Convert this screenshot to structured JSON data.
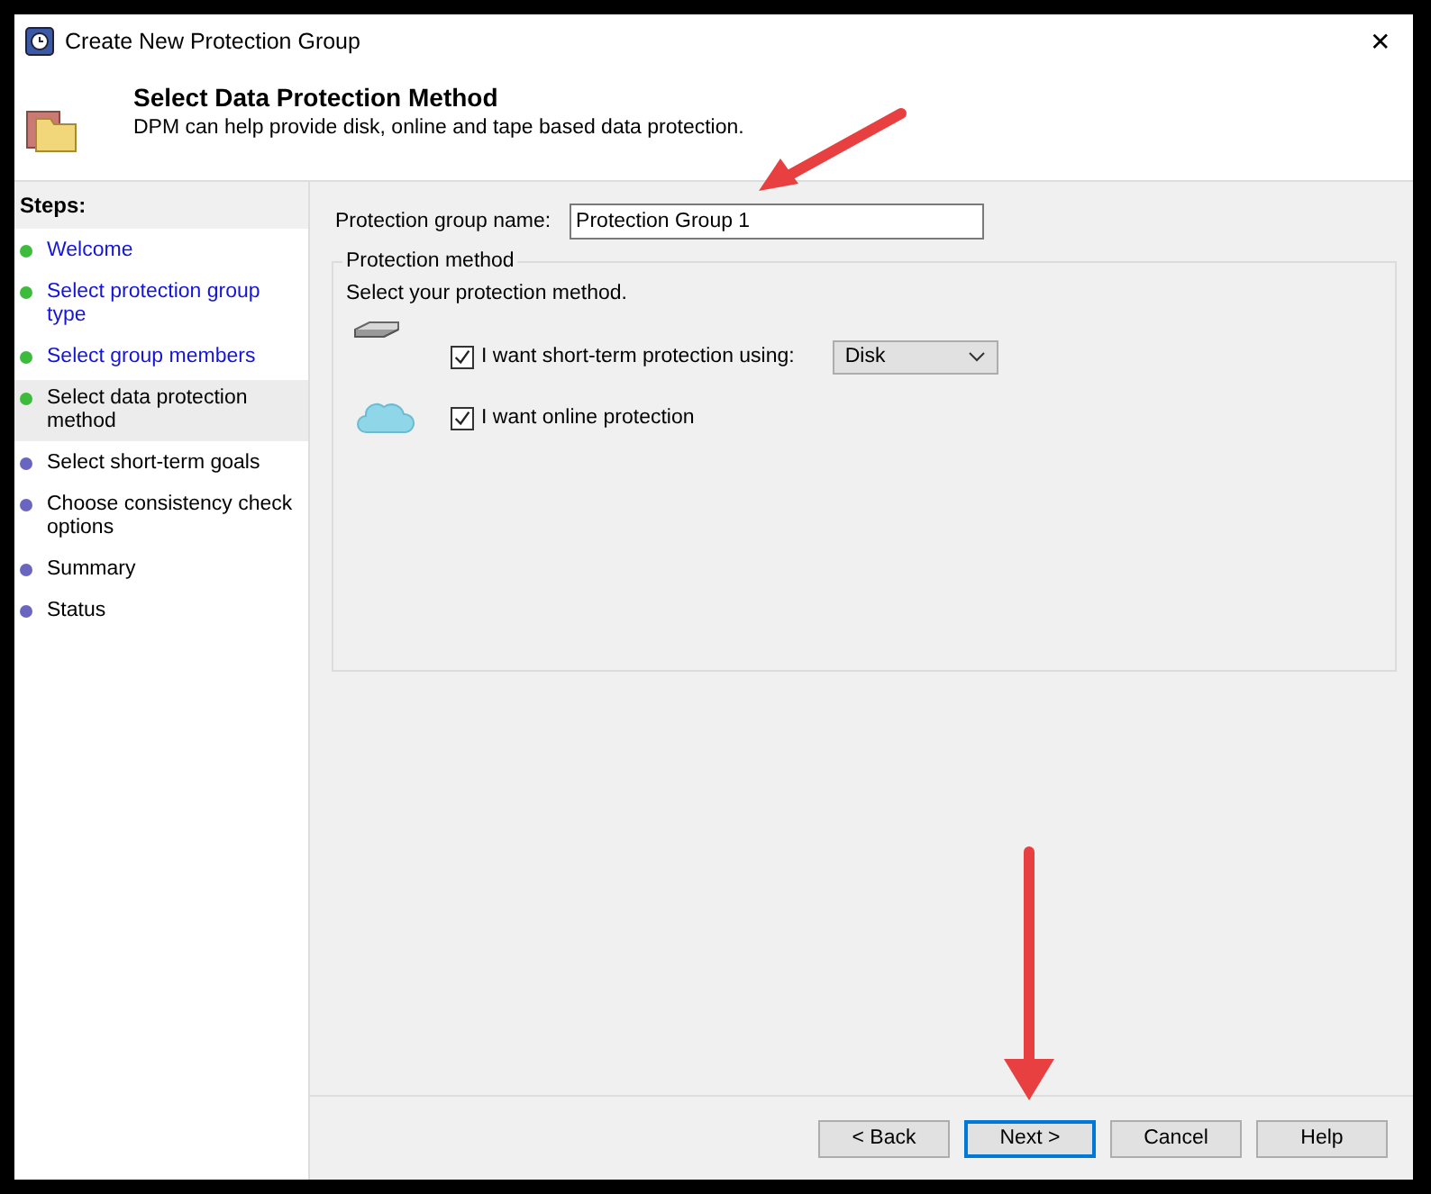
{
  "window": {
    "title": "Create New Protection Group",
    "close": "✕"
  },
  "header": {
    "title": "Select Data Protection Method",
    "subtitle": "DPM can help provide disk, online and tape based data protection."
  },
  "steps": {
    "heading": "Steps:",
    "items": [
      {
        "label": "Welcome",
        "completed": true,
        "selected": false
      },
      {
        "label": "Select protection group type",
        "completed": true,
        "selected": false
      },
      {
        "label": "Select group members",
        "completed": true,
        "selected": false
      },
      {
        "label": "Select data protection method",
        "completed": true,
        "selected": true
      },
      {
        "label": "Select short-term goals",
        "completed": false,
        "selected": false
      },
      {
        "label": "Choose consistency check options",
        "completed": false,
        "selected": false
      },
      {
        "label": "Summary",
        "completed": false,
        "selected": false
      },
      {
        "label": "Status",
        "completed": false,
        "selected": false
      }
    ]
  },
  "group_name": {
    "label": "Protection group name:",
    "value": "Protection Group 1"
  },
  "method": {
    "legend": "Protection method",
    "prompt": "Select your protection method.",
    "options": [
      {
        "kind": "disk",
        "label": "I want short-term protection using:",
        "checked": true,
        "dropdown": "Disk"
      },
      {
        "kind": "cloud",
        "label": "I want online protection",
        "checked": true
      }
    ]
  },
  "buttons": [
    {
      "label": "< Back",
      "focused": false
    },
    {
      "label": "Next >",
      "focused": true
    },
    {
      "label": "Cancel",
      "focused": false
    },
    {
      "label": "Help",
      "focused": false
    }
  ]
}
